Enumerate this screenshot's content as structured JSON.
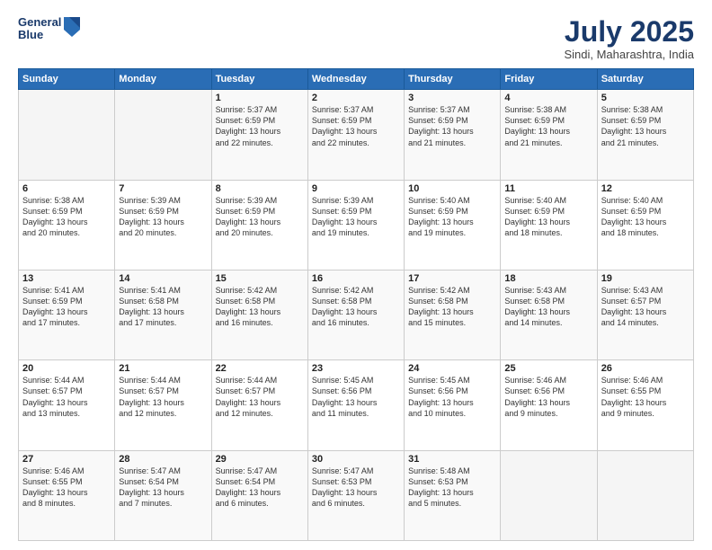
{
  "header": {
    "logo_line1": "General",
    "logo_line2": "Blue",
    "title": "July 2025",
    "subtitle": "Sindi, Maharashtra, India"
  },
  "days_of_week": [
    "Sunday",
    "Monday",
    "Tuesday",
    "Wednesday",
    "Thursday",
    "Friday",
    "Saturday"
  ],
  "weeks": [
    [
      {
        "day": "",
        "info": ""
      },
      {
        "day": "",
        "info": ""
      },
      {
        "day": "1",
        "info": "Sunrise: 5:37 AM\nSunset: 6:59 PM\nDaylight: 13 hours\nand 22 minutes."
      },
      {
        "day": "2",
        "info": "Sunrise: 5:37 AM\nSunset: 6:59 PM\nDaylight: 13 hours\nand 22 minutes."
      },
      {
        "day": "3",
        "info": "Sunrise: 5:37 AM\nSunset: 6:59 PM\nDaylight: 13 hours\nand 21 minutes."
      },
      {
        "day": "4",
        "info": "Sunrise: 5:38 AM\nSunset: 6:59 PM\nDaylight: 13 hours\nand 21 minutes."
      },
      {
        "day": "5",
        "info": "Sunrise: 5:38 AM\nSunset: 6:59 PM\nDaylight: 13 hours\nand 21 minutes."
      }
    ],
    [
      {
        "day": "6",
        "info": "Sunrise: 5:38 AM\nSunset: 6:59 PM\nDaylight: 13 hours\nand 20 minutes."
      },
      {
        "day": "7",
        "info": "Sunrise: 5:39 AM\nSunset: 6:59 PM\nDaylight: 13 hours\nand 20 minutes."
      },
      {
        "day": "8",
        "info": "Sunrise: 5:39 AM\nSunset: 6:59 PM\nDaylight: 13 hours\nand 20 minutes."
      },
      {
        "day": "9",
        "info": "Sunrise: 5:39 AM\nSunset: 6:59 PM\nDaylight: 13 hours\nand 19 minutes."
      },
      {
        "day": "10",
        "info": "Sunrise: 5:40 AM\nSunset: 6:59 PM\nDaylight: 13 hours\nand 19 minutes."
      },
      {
        "day": "11",
        "info": "Sunrise: 5:40 AM\nSunset: 6:59 PM\nDaylight: 13 hours\nand 18 minutes."
      },
      {
        "day": "12",
        "info": "Sunrise: 5:40 AM\nSunset: 6:59 PM\nDaylight: 13 hours\nand 18 minutes."
      }
    ],
    [
      {
        "day": "13",
        "info": "Sunrise: 5:41 AM\nSunset: 6:59 PM\nDaylight: 13 hours\nand 17 minutes."
      },
      {
        "day": "14",
        "info": "Sunrise: 5:41 AM\nSunset: 6:58 PM\nDaylight: 13 hours\nand 17 minutes."
      },
      {
        "day": "15",
        "info": "Sunrise: 5:42 AM\nSunset: 6:58 PM\nDaylight: 13 hours\nand 16 minutes."
      },
      {
        "day": "16",
        "info": "Sunrise: 5:42 AM\nSunset: 6:58 PM\nDaylight: 13 hours\nand 16 minutes."
      },
      {
        "day": "17",
        "info": "Sunrise: 5:42 AM\nSunset: 6:58 PM\nDaylight: 13 hours\nand 15 minutes."
      },
      {
        "day": "18",
        "info": "Sunrise: 5:43 AM\nSunset: 6:58 PM\nDaylight: 13 hours\nand 14 minutes."
      },
      {
        "day": "19",
        "info": "Sunrise: 5:43 AM\nSunset: 6:57 PM\nDaylight: 13 hours\nand 14 minutes."
      }
    ],
    [
      {
        "day": "20",
        "info": "Sunrise: 5:44 AM\nSunset: 6:57 PM\nDaylight: 13 hours\nand 13 minutes."
      },
      {
        "day": "21",
        "info": "Sunrise: 5:44 AM\nSunset: 6:57 PM\nDaylight: 13 hours\nand 12 minutes."
      },
      {
        "day": "22",
        "info": "Sunrise: 5:44 AM\nSunset: 6:57 PM\nDaylight: 13 hours\nand 12 minutes."
      },
      {
        "day": "23",
        "info": "Sunrise: 5:45 AM\nSunset: 6:56 PM\nDaylight: 13 hours\nand 11 minutes."
      },
      {
        "day": "24",
        "info": "Sunrise: 5:45 AM\nSunset: 6:56 PM\nDaylight: 13 hours\nand 10 minutes."
      },
      {
        "day": "25",
        "info": "Sunrise: 5:46 AM\nSunset: 6:56 PM\nDaylight: 13 hours\nand 9 minutes."
      },
      {
        "day": "26",
        "info": "Sunrise: 5:46 AM\nSunset: 6:55 PM\nDaylight: 13 hours\nand 9 minutes."
      }
    ],
    [
      {
        "day": "27",
        "info": "Sunrise: 5:46 AM\nSunset: 6:55 PM\nDaylight: 13 hours\nand 8 minutes."
      },
      {
        "day": "28",
        "info": "Sunrise: 5:47 AM\nSunset: 6:54 PM\nDaylight: 13 hours\nand 7 minutes."
      },
      {
        "day": "29",
        "info": "Sunrise: 5:47 AM\nSunset: 6:54 PM\nDaylight: 13 hours\nand 6 minutes."
      },
      {
        "day": "30",
        "info": "Sunrise: 5:47 AM\nSunset: 6:53 PM\nDaylight: 13 hours\nand 6 minutes."
      },
      {
        "day": "31",
        "info": "Sunrise: 5:48 AM\nSunset: 6:53 PM\nDaylight: 13 hours\nand 5 minutes."
      },
      {
        "day": "",
        "info": ""
      },
      {
        "day": "",
        "info": ""
      }
    ]
  ]
}
